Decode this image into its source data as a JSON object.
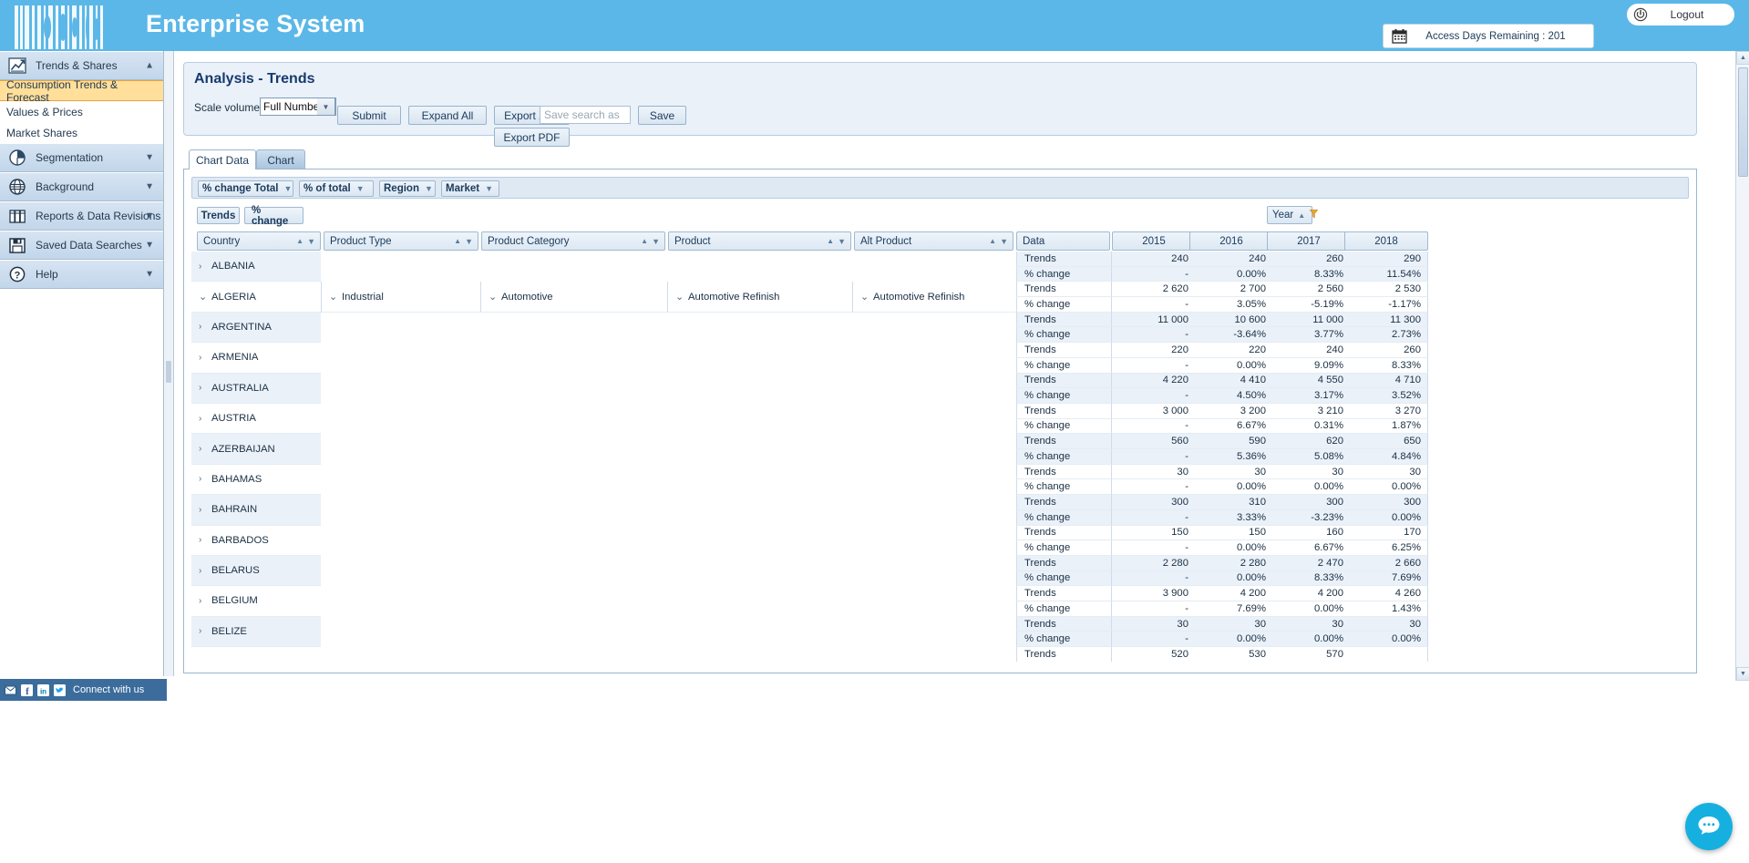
{
  "header": {
    "app_title": "Enterprise System",
    "logo_icon": "barcode-logo",
    "access_days": "Access Days Remaining : 201",
    "calendar_icon": "calendar-icon",
    "logout_label": "Logout",
    "power_icon": "power-icon",
    "brand_color": "#5bb7e8"
  },
  "sidebar": {
    "groups": [
      {
        "label": "Trends & Shares",
        "icon": "chart-line-icon",
        "chevron": "up",
        "expanded": true,
        "children": [
          {
            "label": "Consumption Trends & Forecast",
            "active": true
          },
          {
            "label": "Values & Prices",
            "active": false
          },
          {
            "label": "Market Shares",
            "active": false
          }
        ]
      },
      {
        "label": "Segmentation",
        "icon": "pie-chart-icon",
        "chevron": "down",
        "expanded": false,
        "children": []
      },
      {
        "label": "Background",
        "icon": "globe-icon",
        "chevron": "down",
        "expanded": false,
        "children": []
      },
      {
        "label": "Reports & Data Revisions",
        "icon": "books-icon",
        "chevron": "down",
        "expanded": false,
        "children": []
      },
      {
        "label": "Saved Data Searches",
        "icon": "floppy-disk-icon",
        "chevron": "down",
        "expanded": false,
        "children": []
      },
      {
        "label": "Help",
        "icon": "question-circle-icon",
        "chevron": "down",
        "expanded": false,
        "children": []
      }
    ],
    "social": {
      "text": "Connect with us",
      "icons": [
        "email-icon",
        "facebook-icon",
        "linkedin-icon",
        "twitter-icon"
      ],
      "bar_color": "#3b6c9c"
    }
  },
  "panel": {
    "title": "Analysis - Trends",
    "scale_label": "Scale volumes:",
    "scale_value": "Full Number",
    "buttons": {
      "submit": "Submit",
      "expand_all": "Expand All",
      "export_xls": "Export XLS",
      "export_pdf": "Export PDF",
      "save": "Save"
    },
    "save_search_placeholder": "Save search as",
    "save_search_value": ""
  },
  "tabs": [
    {
      "label": "Chart Data",
      "active": true
    },
    {
      "label": "Chart",
      "active": false
    }
  ],
  "filters": {
    "pills": [
      {
        "label": "% change Total",
        "filter_icon": "filter-icon"
      },
      {
        "label": "% of total",
        "filter_icon": "filter-icon"
      },
      {
        "label": "Region",
        "filter_icon": "filter-icon"
      },
      {
        "label": "Market",
        "filter_icon": "filter-icon"
      }
    ],
    "modes": [
      {
        "label": "Trends",
        "selected": true
      },
      {
        "label": "% change",
        "selected": false
      }
    ],
    "year_pill": {
      "label": "Year",
      "sort": "asc",
      "filter_icon": "filter-icon"
    }
  },
  "grid": {
    "columns": [
      {
        "key": "country",
        "label": "Country",
        "sortable": true,
        "filterable": true
      },
      {
        "key": "ptype",
        "label": "Product Type",
        "sortable": true,
        "filterable": true
      },
      {
        "key": "pcat",
        "label": "Product Category",
        "sortable": true,
        "filterable": true
      },
      {
        "key": "product",
        "label": "Product",
        "sortable": true,
        "filterable": true
      },
      {
        "key": "altprod",
        "label": "Alt Product",
        "sortable": true,
        "filterable": true
      },
      {
        "key": "data",
        "label": "Data",
        "sortable": false,
        "filterable": false
      }
    ],
    "years": [
      "2015",
      "2016",
      "2017",
      "2018"
    ],
    "row_labels": {
      "trends": "Trends",
      "change": "% change"
    },
    "rows": [
      {
        "country": "ALBANIA",
        "expanded": false,
        "ptype": "",
        "pcat": "",
        "product": "",
        "altprod": "",
        "trends": [
          "240",
          "240",
          "260",
          "290"
        ],
        "change": [
          "-",
          "0.00%",
          "8.33%",
          "11.54%"
        ]
      },
      {
        "country": "ALGERIA",
        "expanded": true,
        "ptype": "Industrial",
        "pcat": "Automotive",
        "product": "Automotive Refinish",
        "altprod": "Automotive Refinish",
        "trends": [
          "2 620",
          "2 700",
          "2 560",
          "2 530"
        ],
        "change": [
          "-",
          "3.05%",
          "-5.19%",
          "-1.17%"
        ]
      },
      {
        "country": "ARGENTINA",
        "expanded": false,
        "ptype": "",
        "pcat": "",
        "product": "",
        "altprod": "",
        "trends": [
          "11 000",
          "10 600",
          "11 000",
          "11 300"
        ],
        "change": [
          "-",
          "-3.64%",
          "3.77%",
          "2.73%"
        ]
      },
      {
        "country": "ARMENIA",
        "expanded": false,
        "ptype": "",
        "pcat": "",
        "product": "",
        "altprod": "",
        "trends": [
          "220",
          "220",
          "240",
          "260"
        ],
        "change": [
          "-",
          "0.00%",
          "9.09%",
          "8.33%"
        ]
      },
      {
        "country": "AUSTRALIA",
        "expanded": false,
        "ptype": "",
        "pcat": "",
        "product": "",
        "altprod": "",
        "trends": [
          "4 220",
          "4 410",
          "4 550",
          "4 710"
        ],
        "change": [
          "-",
          "4.50%",
          "3.17%",
          "3.52%"
        ]
      },
      {
        "country": "AUSTRIA",
        "expanded": false,
        "ptype": "",
        "pcat": "",
        "product": "",
        "altprod": "",
        "trends": [
          "3 000",
          "3 200",
          "3 210",
          "3 270"
        ],
        "change": [
          "-",
          "6.67%",
          "0.31%",
          "1.87%"
        ]
      },
      {
        "country": "AZERBAIJAN",
        "expanded": false,
        "ptype": "",
        "pcat": "",
        "product": "",
        "altprod": "",
        "trends": [
          "560",
          "590",
          "620",
          "650"
        ],
        "change": [
          "-",
          "5.36%",
          "5.08%",
          "4.84%"
        ]
      },
      {
        "country": "BAHAMAS",
        "expanded": false,
        "ptype": "",
        "pcat": "",
        "product": "",
        "altprod": "",
        "trends": [
          "30",
          "30",
          "30",
          "30"
        ],
        "change": [
          "-",
          "0.00%",
          "0.00%",
          "0.00%"
        ]
      },
      {
        "country": "BAHRAIN",
        "expanded": false,
        "ptype": "",
        "pcat": "",
        "product": "",
        "altprod": "",
        "trends": [
          "300",
          "310",
          "300",
          "300"
        ],
        "change": [
          "-",
          "3.33%",
          "-3.23%",
          "0.00%"
        ]
      },
      {
        "country": "BARBADOS",
        "expanded": false,
        "ptype": "",
        "pcat": "",
        "product": "",
        "altprod": "",
        "trends": [
          "150",
          "150",
          "160",
          "170"
        ],
        "change": [
          "-",
          "0.00%",
          "6.67%",
          "6.25%"
        ]
      },
      {
        "country": "BELARUS",
        "expanded": false,
        "ptype": "",
        "pcat": "",
        "product": "",
        "altprod": "",
        "trends": [
          "2 280",
          "2 280",
          "2 470",
          "2 660"
        ],
        "change": [
          "-",
          "0.00%",
          "8.33%",
          "7.69%"
        ]
      },
      {
        "country": "BELGIUM",
        "expanded": false,
        "ptype": "",
        "pcat": "",
        "product": "",
        "altprod": "",
        "trends": [
          "3 900",
          "4 200",
          "4 200",
          "4 260"
        ],
        "change": [
          "-",
          "7.69%",
          "0.00%",
          "1.43%"
        ]
      },
      {
        "country": "BELIZE",
        "expanded": false,
        "ptype": "",
        "pcat": "",
        "product": "",
        "altprod": "",
        "trends": [
          "30",
          "30",
          "30",
          "30"
        ],
        "change": [
          "-",
          "0.00%",
          "0.00%",
          "0.00%"
        ]
      },
      {
        "country": "",
        "expanded": false,
        "ptype": "",
        "pcat": "",
        "product": "",
        "altprod": "",
        "trends": [
          "520",
          "530",
          "570",
          ""
        ],
        "change": [
          "",
          "",
          "",
          ""
        ]
      }
    ]
  },
  "chat": {
    "icon": "chat-bubble-icon",
    "color": "#16b0e0"
  }
}
